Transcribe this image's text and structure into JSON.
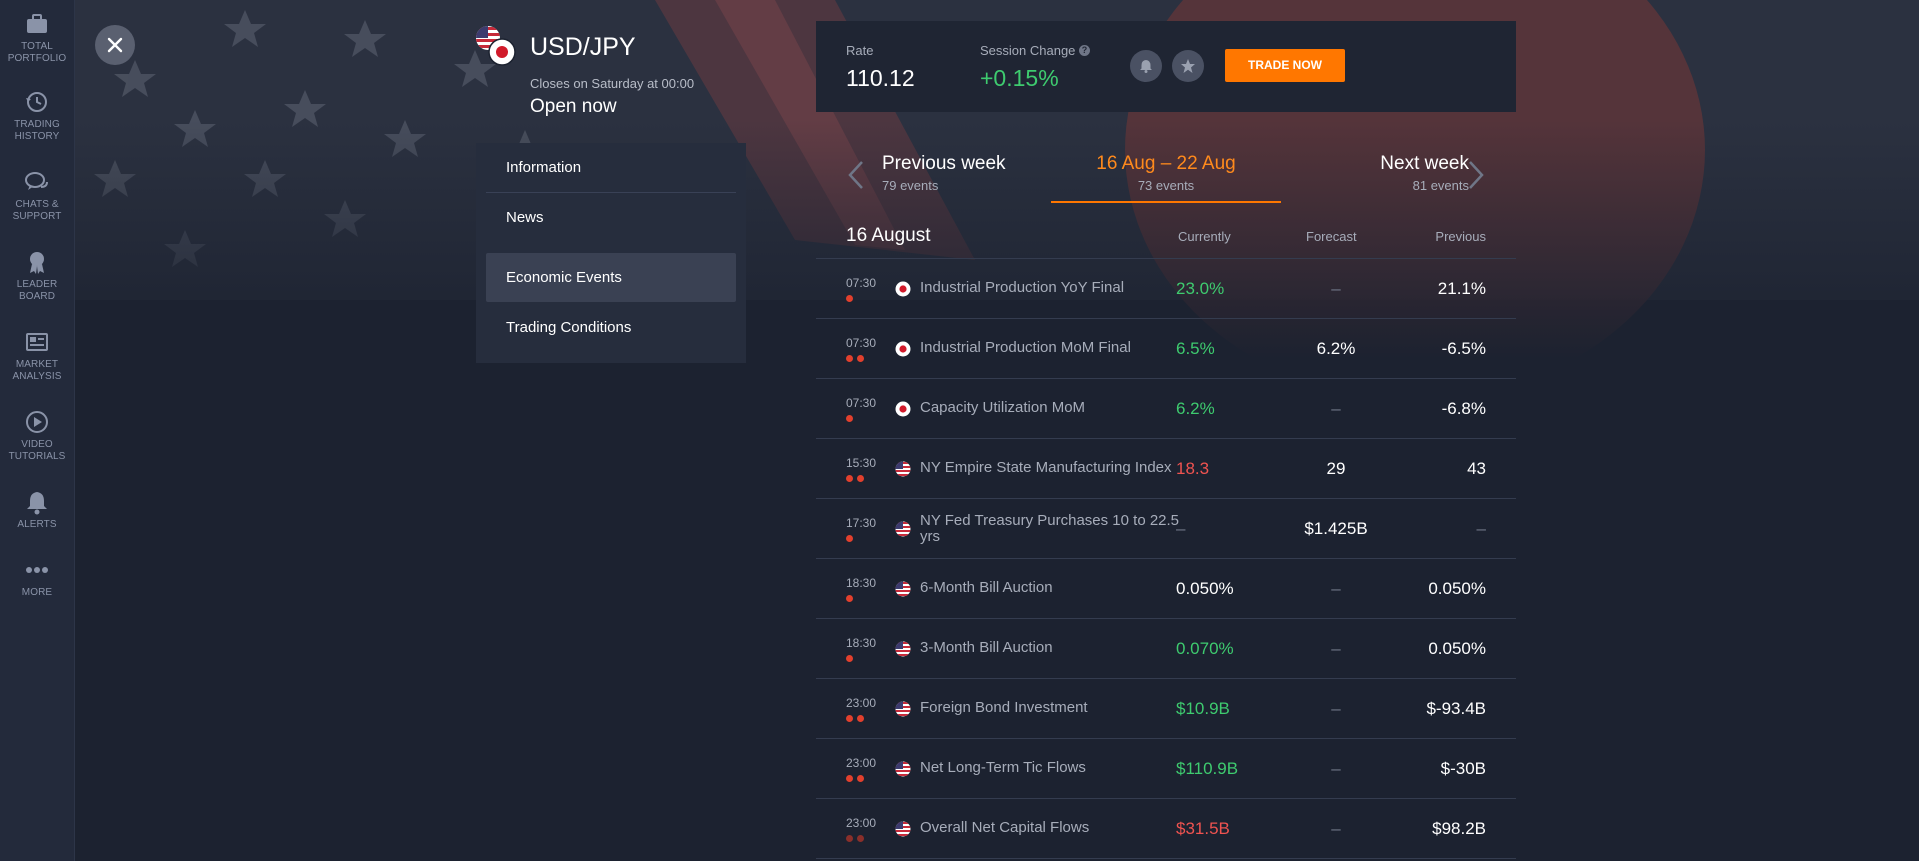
{
  "sidebar": {
    "items": [
      {
        "label": "TOTAL\nPORTFOLIO",
        "icon": "briefcase-icon"
      },
      {
        "label": "TRADING\nHISTORY",
        "icon": "history-icon"
      },
      {
        "label": "CHATS &\nSUPPORT",
        "icon": "chat-icon"
      },
      {
        "label": "LEADER\nBOARD",
        "icon": "medal-icon"
      },
      {
        "label": "MARKET\nANALYSIS",
        "icon": "newspaper-icon"
      },
      {
        "label": "VIDEO\nTUTORIALS",
        "icon": "play-icon"
      },
      {
        "label": "ALERTS",
        "icon": "bell-icon"
      },
      {
        "label": "MORE",
        "icon": "more-dots-icon"
      }
    ]
  },
  "asset": {
    "name": "USD/JPY",
    "closes": "Closes on Saturday at 00:00",
    "status": "Open now"
  },
  "menu": {
    "items": [
      "Information",
      "News",
      "Economic Events",
      "Trading Conditions"
    ],
    "active": "Economic Events"
  },
  "rate_panel": {
    "rate_label": "Rate",
    "rate_value": "110.12",
    "change_label": "Session Change",
    "change_value": "+0.15%",
    "help_glyph": "?",
    "trade_button": "TRADE NOW"
  },
  "week_nav": {
    "prev_title": "Previous week",
    "prev_sub": "79 events",
    "current_title": "16 Aug – 22 Aug",
    "current_sub": "73 events",
    "next_title": "Next week",
    "next_sub": "81 events"
  },
  "events": {
    "day": "16 August",
    "col_currently": "Currently",
    "col_forecast": "Forecast",
    "col_previous": "Previous",
    "rows": [
      {
        "time": "07:30",
        "flag": "jp",
        "impact": 1,
        "name": "Industrial Production YoY Final",
        "currently": "23.0%",
        "cur_color": "#3ecb6f",
        "forecast": "–",
        "previous": "21.1%"
      },
      {
        "time": "07:30",
        "flag": "jp",
        "impact": 2,
        "name": "Industrial Production MoM Final",
        "currently": "6.5%",
        "cur_color": "#3ecb6f",
        "forecast": "6.2%",
        "previous": "-6.5%"
      },
      {
        "time": "07:30",
        "flag": "jp",
        "impact": 1,
        "name": "Capacity Utilization MoM",
        "currently": "6.2%",
        "cur_color": "#3ecb6f",
        "forecast": "–",
        "previous": "-6.8%"
      },
      {
        "time": "15:30",
        "flag": "us",
        "impact": 2,
        "name": "NY Empire State Manufacturing Index",
        "currently": "18.3",
        "cur_color": "#ef5350",
        "forecast": "29",
        "previous": "43"
      },
      {
        "time": "17:30",
        "flag": "us",
        "impact": 1,
        "name": "NY Fed Treasury Purchases 10 to 22.5 yrs",
        "currently": "–",
        "cur_color": "#6f7687",
        "forecast": "$1.425B",
        "previous": "–"
      },
      {
        "time": "18:30",
        "flag": "us",
        "impact": 1,
        "name": "6-Month Bill Auction",
        "currently": "0.050%",
        "cur_color": "#ffffff",
        "forecast": "–",
        "previous": "0.050%"
      },
      {
        "time": "18:30",
        "flag": "us",
        "impact": 1,
        "name": "3-Month Bill Auction",
        "currently": "0.070%",
        "cur_color": "#3ecb6f",
        "forecast": "–",
        "previous": "0.050%"
      },
      {
        "time": "23:00",
        "flag": "us",
        "impact": 2,
        "name": "Foreign Bond Investment",
        "currently": "$10.9B",
        "cur_color": "#3ecb6f",
        "forecast": "–",
        "previous": "$-93.4B"
      },
      {
        "time": "23:00",
        "flag": "us",
        "impact": 2,
        "name": "Net Long-Term Tic Flows",
        "currently": "$110.9B",
        "cur_color": "#3ecb6f",
        "forecast": "–",
        "previous": "$-30B"
      },
      {
        "time": "23:00",
        "flag": "us",
        "impact": 2,
        "name": "Overall Net Capital Flows",
        "currently": "$31.5B",
        "cur_color": "#ef5350",
        "forecast": "–",
        "previous": "$98.2B"
      }
    ]
  },
  "colors": {
    "accent": "#ff7700",
    "positive": "#3ecb6f",
    "negative": "#ef5350",
    "background": "#1c2230"
  }
}
